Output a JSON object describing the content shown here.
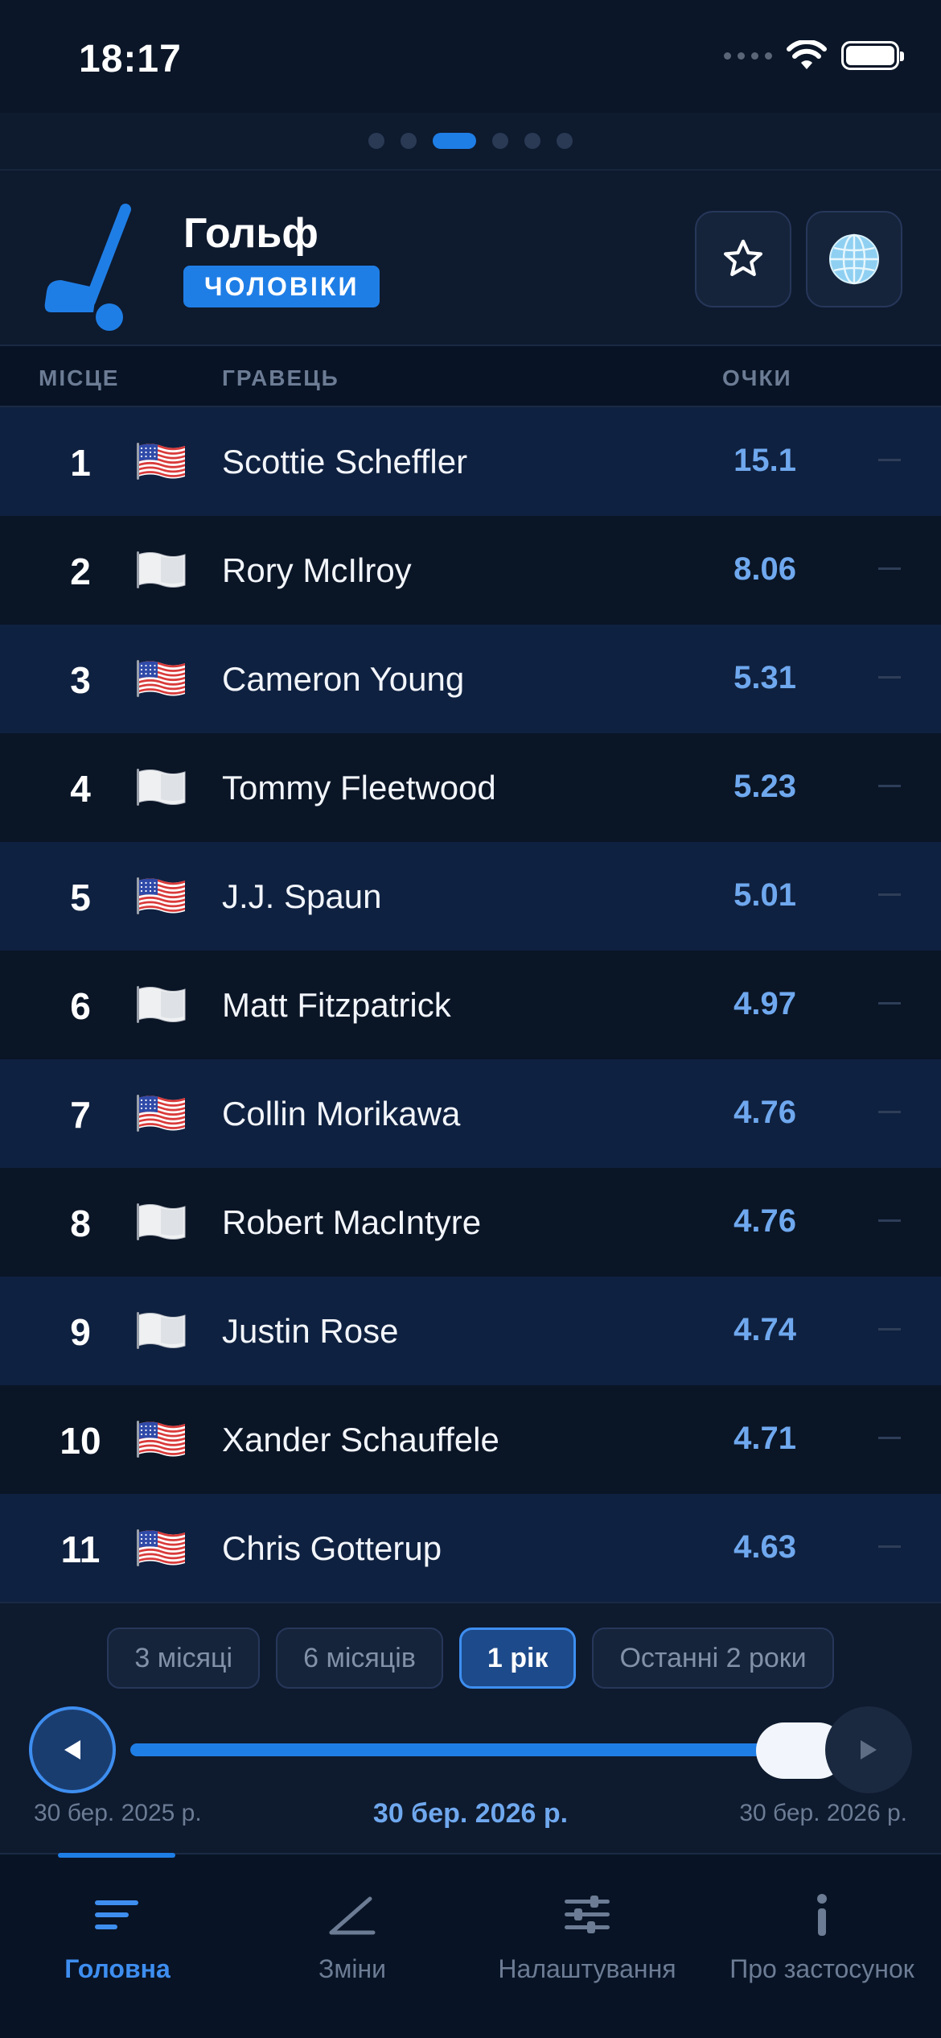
{
  "status_bar": {
    "time": "18:17"
  },
  "pager": {
    "count": 6,
    "active_index": 2
  },
  "header": {
    "sport_icon": "golf-club-icon",
    "title": "Гольф",
    "badge": "ЧОЛОВІКИ",
    "favorite_icon": "star-icon",
    "region_icon": "globe-icon"
  },
  "table": {
    "columns": {
      "rank": "МІСЦЕ",
      "player": "ГРАВЕЦЬ",
      "points": "ОЧКИ"
    },
    "rows": [
      {
        "rank": "1",
        "flag": "us-flag-icon",
        "name": "Scottie Scheffler",
        "points": "15.1",
        "trend": "—"
      },
      {
        "rank": "2",
        "flag": "white-flag-icon",
        "name": "Rory McIlroy",
        "points": "8.06",
        "trend": "—"
      },
      {
        "rank": "3",
        "flag": "us-flag-icon",
        "name": "Cameron Young",
        "points": "5.31",
        "trend": "—"
      },
      {
        "rank": "4",
        "flag": "white-flag-icon",
        "name": "Tommy Fleetwood",
        "points": "5.23",
        "trend": "—"
      },
      {
        "rank": "5",
        "flag": "us-flag-icon",
        "name": "J.J. Spaun",
        "points": "5.01",
        "trend": "—"
      },
      {
        "rank": "6",
        "flag": "white-flag-icon",
        "name": "Matt Fitzpatrick",
        "points": "4.97",
        "trend": "—"
      },
      {
        "rank": "7",
        "flag": "us-flag-icon",
        "name": "Collin Morikawa",
        "points": "4.76",
        "trend": "—"
      },
      {
        "rank": "8",
        "flag": "white-flag-icon",
        "name": "Robert MacIntyre",
        "points": "4.76",
        "trend": "—"
      },
      {
        "rank": "9",
        "flag": "white-flag-icon",
        "name": "Justin Rose",
        "points": "4.74",
        "trend": "—"
      },
      {
        "rank": "10",
        "flag": "us-flag-icon",
        "name": "Xander Schauffele",
        "points": "4.71",
        "trend": "—"
      },
      {
        "rank": "11",
        "flag": "us-flag-icon",
        "name": "Chris Gotterup",
        "points": "4.63",
        "trend": "—"
      }
    ]
  },
  "periods": {
    "options": [
      "3 місяці",
      "6 місяців",
      "1 рік",
      "Останні 2 роки"
    ],
    "selected": "1 рік"
  },
  "timeline": {
    "start_date": "30 бер. 2025 р.",
    "current_date": "30 бер. 2026 р.",
    "end_date": "30 бер. 2026 р.",
    "position": 1.0,
    "prev_icon": "triangle-left-icon",
    "next_icon": "triangle-right-icon"
  },
  "tabs": [
    {
      "label": "Головна",
      "icon": "list-icon",
      "active": true
    },
    {
      "label": "Зміни",
      "icon": "chart-line-icon",
      "active": false
    },
    {
      "label": "Налаштування",
      "icon": "sliders-icon",
      "active": false
    },
    {
      "label": "Про застосунок",
      "icon": "info-icon",
      "active": false
    }
  ],
  "colors": {
    "background": "#0b1628",
    "accent": "#1f7ee6",
    "points": "#6fa8ee",
    "row_odd": "#0f2140",
    "row_even": "#0a1526"
  }
}
